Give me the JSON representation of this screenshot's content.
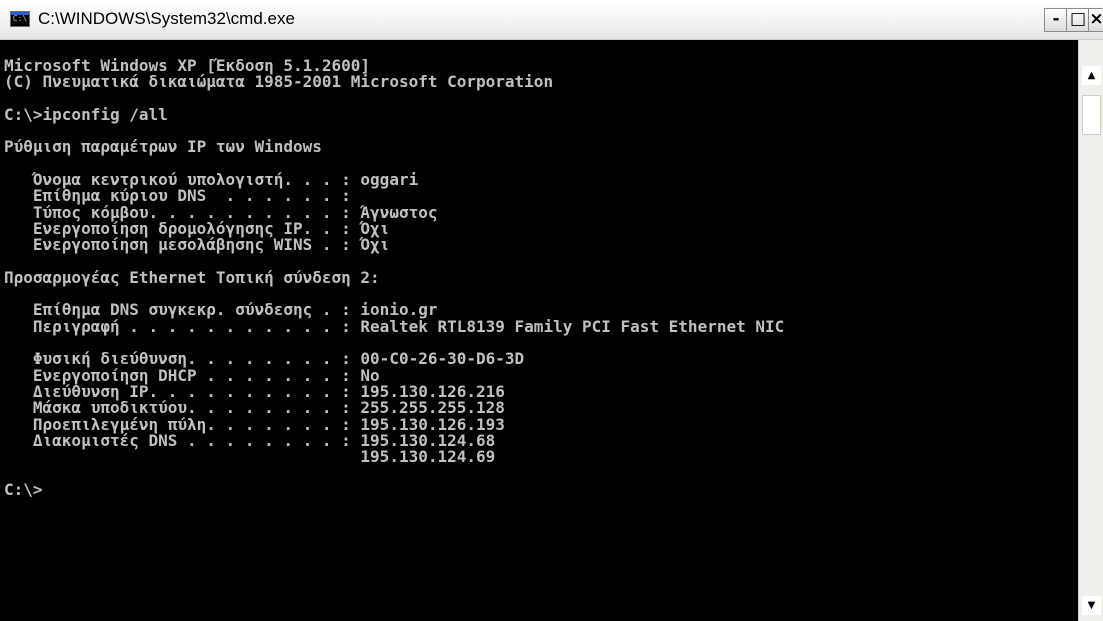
{
  "window": {
    "title": "C:\\WINDOWS\\System32\\cmd.exe",
    "icon_label": "C:\\",
    "buttons": {
      "minimize": "-",
      "maximize": "□",
      "close": "×"
    }
  },
  "console": {
    "lines": [
      "Microsoft Windows XP [Έκδοση 5.1.2600]",
      "(C) Πνευματικά δικαιώματα 1985-2001 Microsoft Corporation",
      "",
      "C:\\>ipconfig /all",
      "",
      "Ρύθμιση παραμέτρων IP των Windows",
      "",
      "   Όνομα κεντρικού υπολογιστή. . . : oggari",
      "   Επίθημα κύριου DNS  . . . . . . :",
      "   Τύπος κόμβου. . . . . . . . . . : Άγνωστος",
      "   Ενεργοποίηση δρομολόγησης IP. . : Όχι",
      "   Ενεργοποίηση μεσολάβησης WINS . : Όχι",
      "",
      "Προσαρμογέας Ethernet Τοπική σύνδεση 2:",
      "",
      "   Επίθημα DNS συγκεκρ. σύνδεσης . : ionio.gr",
      "   Περιγραφή . . . . . . . . . . . : Realtek RTL8139 Family PCI Fast Ethernet NIC",
      "",
      "   Φυσική διεύθυνση. . . . . . . . : 00-C0-26-30-D6-3D",
      "   Ενεργοποίηση DHCP . . . . . . . : No",
      "   Διεύθυνση IP. . . . . . . . . . : 195.130.126.216",
      "   Μάσκα υποδικτύου. . . . . . . . : 255.255.255.128",
      "   Προεπιλεγμένη πύλη. . . . . . . : 195.130.126.193",
      "   Διακομιστές DNS . . . . . . . . : 195.130.124.68",
      "                                     195.130.124.69",
      "",
      "C:\\>"
    ]
  },
  "scrollbar": {
    "up_arrow": "▲",
    "down_arrow": "▼"
  }
}
